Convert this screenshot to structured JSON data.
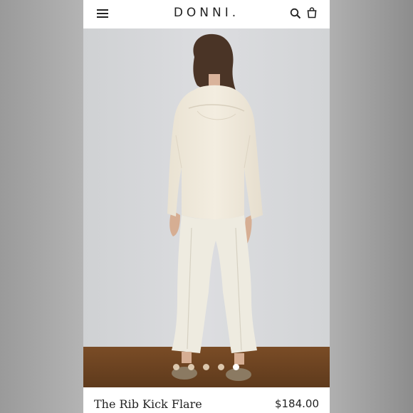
{
  "header": {
    "logo": "DONNI.",
    "icons": {
      "menu": "hamburger-menu-icon",
      "search": "search-icon",
      "cart": "shopping-bag-icon"
    }
  },
  "gallery": {
    "image_count": 5,
    "active_index": 4
  },
  "product": {
    "name": "The Rib Kick Flare",
    "price": "$184.00"
  },
  "colors": {
    "dot_inactive": "#e8d6bd",
    "dot_active": "#ffffff",
    "background_wall": "#d8d9db",
    "floor": "#6e4422"
  }
}
